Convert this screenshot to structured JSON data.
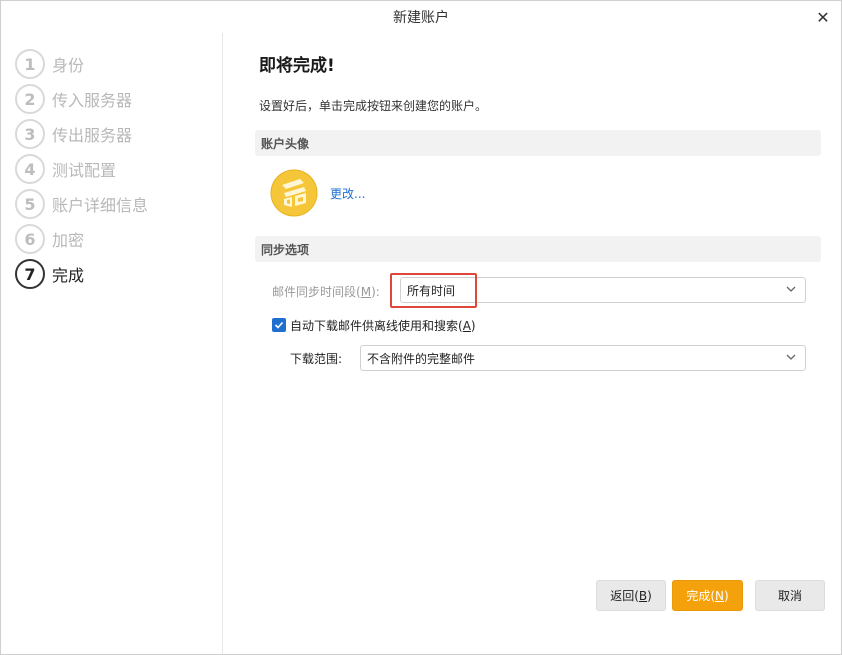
{
  "window": {
    "title": "新建账户"
  },
  "steps": [
    {
      "num": "1",
      "label": "身份"
    },
    {
      "num": "2",
      "label": "传入服务器"
    },
    {
      "num": "3",
      "label": "传出服务器"
    },
    {
      "num": "4",
      "label": "测试配置"
    },
    {
      "num": "5",
      "label": "账户详细信息"
    },
    {
      "num": "6",
      "label": "加密"
    },
    {
      "num": "7",
      "label": "完成"
    }
  ],
  "active_step": 7,
  "main": {
    "heading": "即将完成!",
    "description": "设置好后，单击完成按钮来创建您的账户。",
    "avatar_section": {
      "title": "账户头像",
      "change_link": "更改..."
    },
    "sync_section": {
      "title": "同步选项",
      "period_label": "邮件同步时间段",
      "period_mnemonic_pre": "(",
      "period_mnemonic": "M",
      "period_mnemonic_post": "):",
      "period_value": "所有时间",
      "auto_download_label": "自动下载邮件供离线使用和搜索",
      "auto_download_mnemonic_pre": "(",
      "auto_download_mnemonic": "A",
      "auto_download_mnemonic_post": ")",
      "auto_download_checked": true,
      "range_label": "下载范围:",
      "range_value": "不含附件的完整邮件"
    }
  },
  "buttons": {
    "back": {
      "text": "返回",
      "pre": "(",
      "key": "B",
      "post": ")"
    },
    "finish": {
      "text": "完成",
      "pre": "(",
      "key": "N",
      "post": ")"
    },
    "cancel": "取消"
  },
  "colors": {
    "accent": "#f5a10b",
    "link": "#1f6fd1",
    "highlight": "#e0463a"
  }
}
